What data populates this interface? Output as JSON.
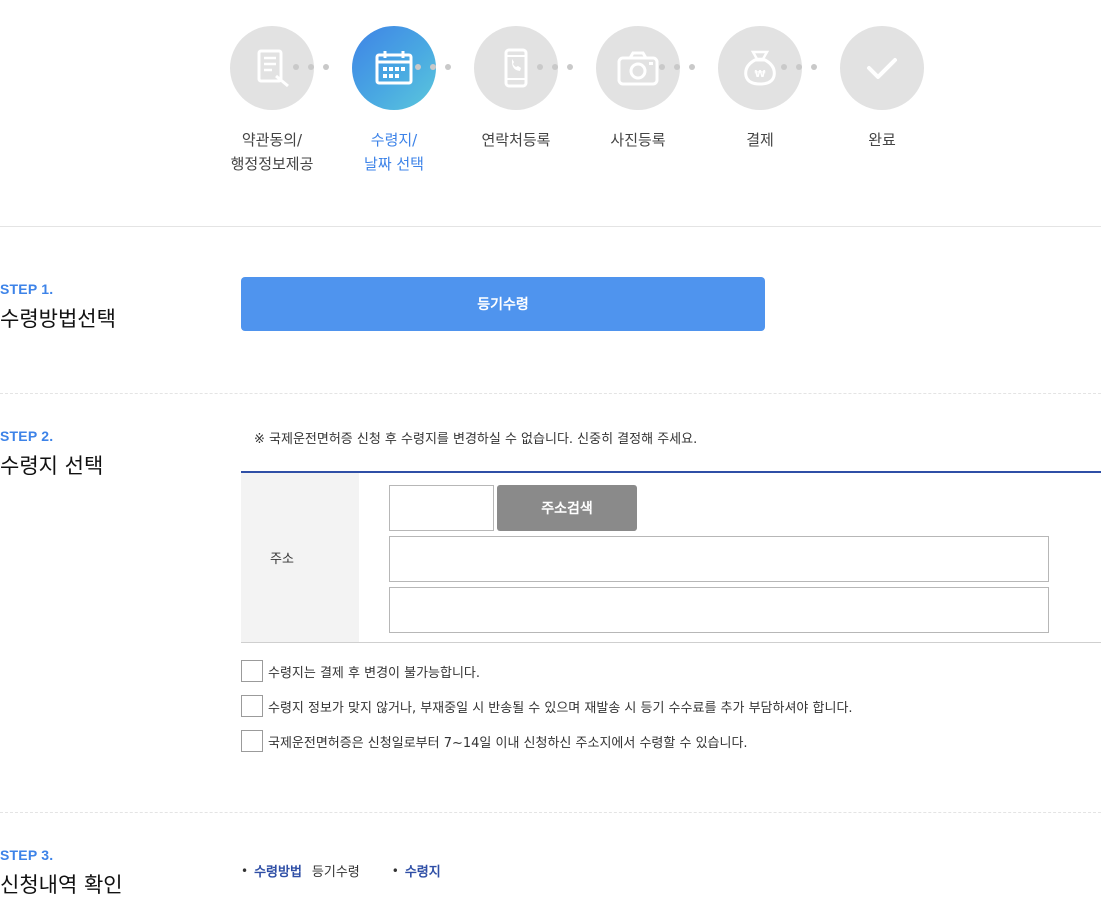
{
  "steps": [
    {
      "label_line1": "약관동의/",
      "label_line2": "행정정보제공",
      "icon": "document-edit-icon",
      "active": false
    },
    {
      "label_line1": "수령지/",
      "label_line2": "날짜 선택",
      "icon": "calendar-icon",
      "active": true
    },
    {
      "label_line1": "연락처등록",
      "label_line2": "",
      "icon": "phone-icon",
      "active": false
    },
    {
      "label_line1": "사진등록",
      "label_line2": "",
      "icon": "camera-icon",
      "active": false
    },
    {
      "label_line1": "결제",
      "label_line2": "",
      "icon": "money-bag-icon",
      "active": false
    },
    {
      "label_line1": "완료",
      "label_line2": "",
      "icon": "check-icon",
      "active": false
    }
  ],
  "step1": {
    "no": "STEP 1.",
    "title": "수령방법선택",
    "button_label": "등기수령"
  },
  "step2": {
    "no": "STEP 2.",
    "title": "수령지 선택",
    "notice": "※ 국제운전면허증 신청 후 수령지를 변경하실 수 없습니다. 신중히 결정해 주세요.",
    "address_label": "주소",
    "zip_value": "",
    "search_button": "주소검색",
    "address1_value": "",
    "address2_value": "",
    "agreements": [
      "수령지는 결제 후 변경이 불가능합니다.",
      "수령지 정보가 맞지 않거나, 부재중일 시 반송될 수 있으며 재발송 시 등기 수수료를 추가 부담하셔야 합니다.",
      "국제운전면허증은 신청일로부터 7~14일 이내 신청하신 주소지에서 수령할 수 있습니다."
    ]
  },
  "step3": {
    "no": "STEP 3.",
    "title": "신청내역 확인",
    "items": [
      {
        "key": "수령방법",
        "value": "등기수령"
      },
      {
        "key": "수령지",
        "value": ""
      }
    ]
  },
  "colors": {
    "accent": "#3d83e8",
    "primary_button": "#4f94ee",
    "navy": "#2f4fa6",
    "inactive_circle": "#e2e2e2",
    "gray_button": "#8a8a8a"
  }
}
